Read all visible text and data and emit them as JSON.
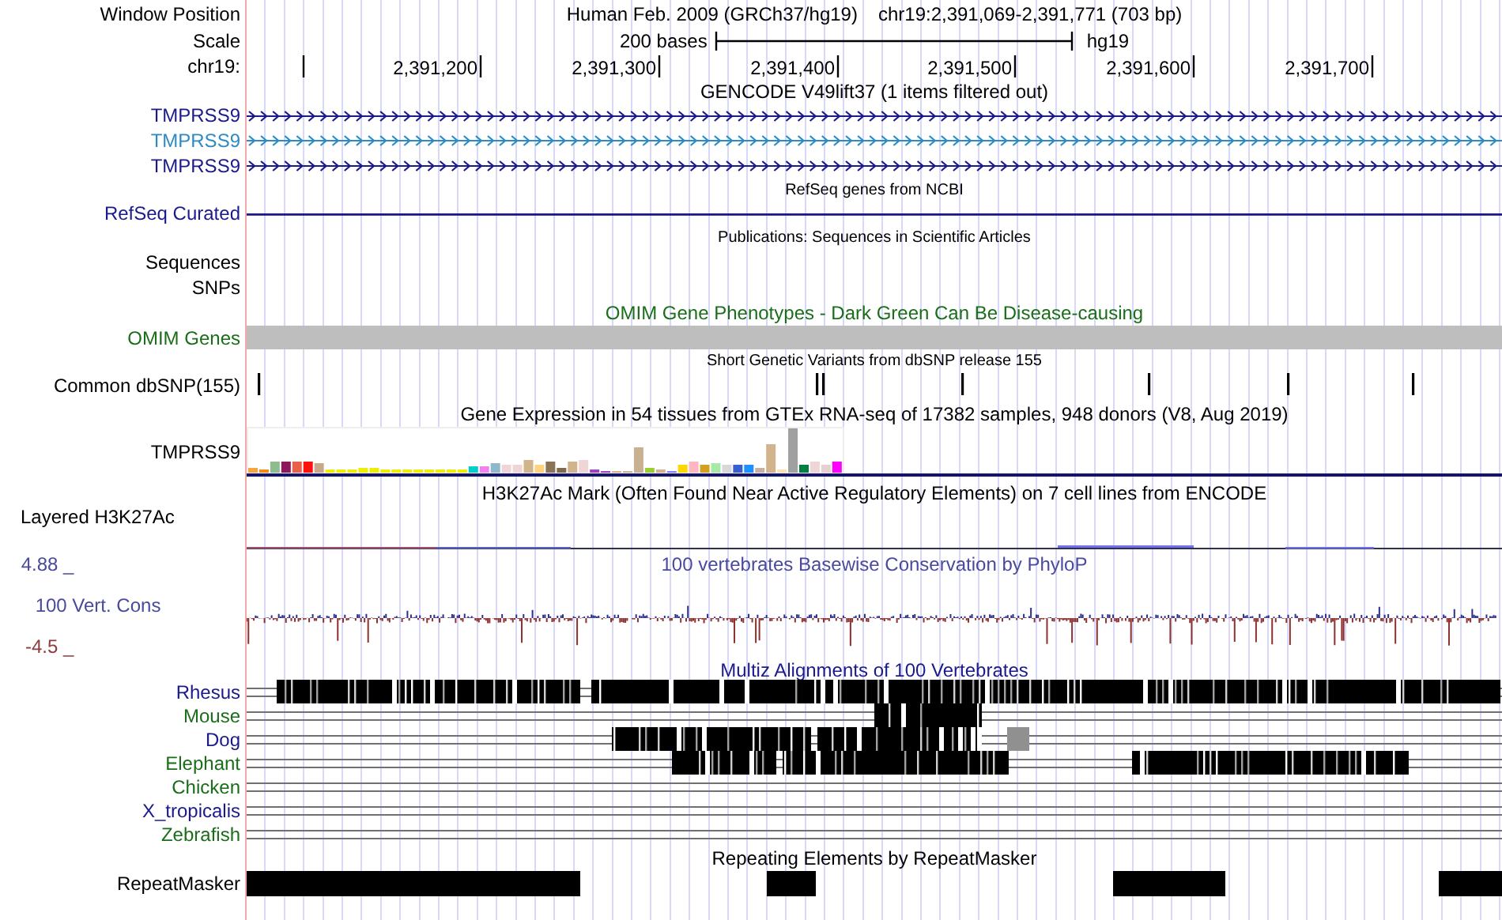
{
  "header": {
    "label": "Window Position",
    "assembly": "Human Feb. 2009 (GRCh37/hg19)",
    "position": "chr19:2,391,069-2,391,771 (703 bp)"
  },
  "scale": {
    "label": "Scale",
    "bar_text": "200 bases",
    "assembly": "hg19"
  },
  "ruler": {
    "label": "chr19:",
    "ticks": [
      "2,391,200",
      "2,391,300",
      "2,391,400",
      "2,391,500",
      "2,391,600",
      "2,391,700"
    ]
  },
  "tracks": [
    {
      "kind": "genes",
      "title": "GENCODE V49lift37 (1 items filtered out)",
      "items": [
        {
          "name": "TMPRSS9",
          "color": "#1a1a8c"
        },
        {
          "name": "TMPRSS9",
          "color": "#2d8bc4"
        },
        {
          "name": "TMPRSS9",
          "color": "#1a1a8c"
        }
      ]
    },
    {
      "kind": "refseq",
      "title": "RefSeq genes from NCBI",
      "label": "RefSeq Curated",
      "color": "#1a1a8c"
    },
    {
      "kind": "publications",
      "title": "Publications: Sequences in Scientific Articles",
      "labels": [
        "Sequences",
        "SNPs"
      ]
    },
    {
      "kind": "omim",
      "title": "OMIM Gene Phenotypes - Dark Green Can Be Disease-causing",
      "label": "OMIM Genes",
      "color": "#1a6e1a"
    },
    {
      "kind": "snps",
      "title": "Short Genetic Variants from dbSNP release 155",
      "label": "Common dbSNP(155)"
    },
    {
      "kind": "expression",
      "title": "Gene Expression in 54 tissues from GTEx RNA-seq of 17382 samples, 948 donors (V8, Aug 2019)",
      "label": "TMPRSS9"
    },
    {
      "kind": "layered",
      "title": "H3K27Ac Mark (Often Found Near Active Regulatory Elements) on 7 cell lines from ENCODE",
      "label": "Layered H3K27Ac"
    },
    {
      "kind": "wiggle",
      "title": "100 vertebrates Basewise Conservation by PhyloP",
      "label": "100 Vert. Cons",
      "max": "4.88 _",
      "min": "-4.5 _",
      "color": "#4a4a9c"
    },
    {
      "kind": "alignment",
      "title": "Multiz Alignments of 100 Vertebrates",
      "color": "#1a1a8c",
      "species": [
        {
          "name": "Rhesus",
          "color": "#1a1a8c"
        },
        {
          "name": "Mouse",
          "color": "#1a6e1a"
        },
        {
          "name": "Dog",
          "color": "#1a1a8c"
        },
        {
          "name": "Elephant",
          "color": "#1a6e1a"
        },
        {
          "name": "Chicken",
          "color": "#1a6e1a"
        },
        {
          "name": "X_tropicalis",
          "color": "#1a1a8c"
        },
        {
          "name": "Zebrafish",
          "color": "#1a6e1a"
        }
      ]
    },
    {
      "kind": "repeats",
      "title": "Repeating Elements by RepeatMasker",
      "label": "RepeatMasker"
    }
  ]
}
